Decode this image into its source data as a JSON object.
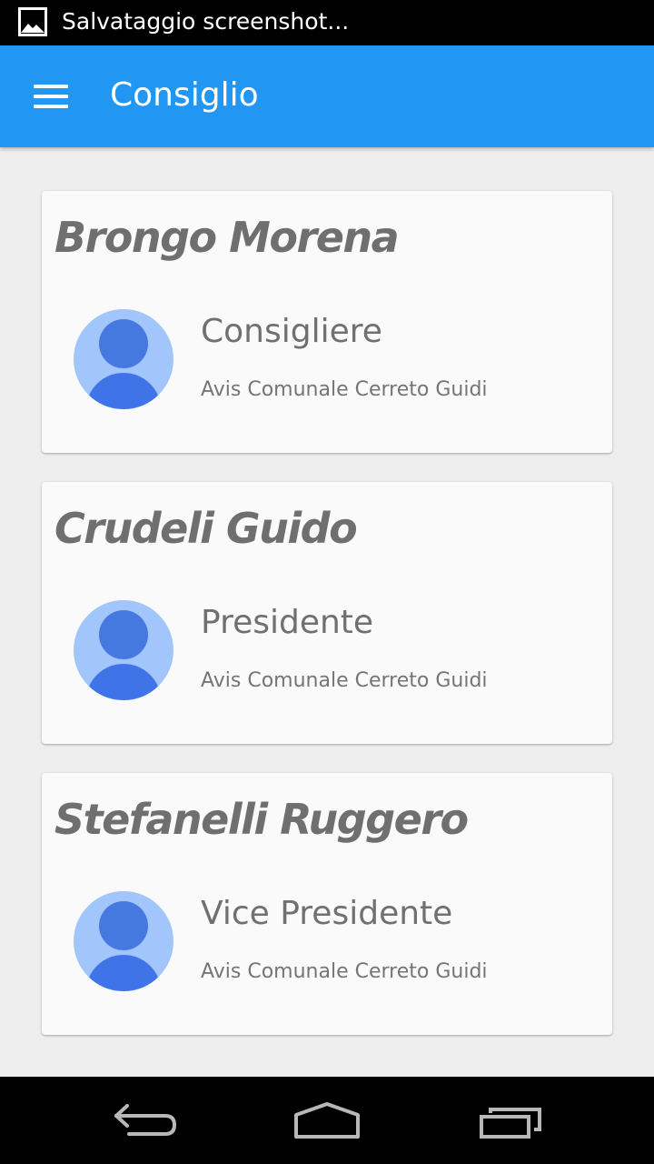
{
  "status_bar": {
    "notification_icon": "image-icon",
    "text": "Salvataggio screenshot..."
  },
  "app_bar": {
    "menu_icon": "menu-icon",
    "title": "Consiglio"
  },
  "members": [
    {
      "name": "Brongo Morena",
      "role": "Consigliere",
      "organization": "Avis Comunale Cerreto Guidi",
      "avatar_icon": "person-avatar-icon"
    },
    {
      "name": "Crudeli Guido",
      "role": "Presidente",
      "organization": "Avis Comunale Cerreto Guidi",
      "avatar_icon": "person-avatar-icon"
    },
    {
      "name": "Stefanelli Ruggero",
      "role": "Vice Presidente",
      "organization": "Avis Comunale Cerreto Guidi",
      "avatar_icon": "person-avatar-icon"
    }
  ],
  "nav_bar": {
    "back_icon": "back-icon",
    "home_icon": "home-icon",
    "recents_icon": "recent-apps-icon"
  },
  "colors": {
    "primary": "#2196f3",
    "avatar_light": "#a2c5fb",
    "avatar_dark": "#3f74e8",
    "text_gray": "#707070"
  }
}
